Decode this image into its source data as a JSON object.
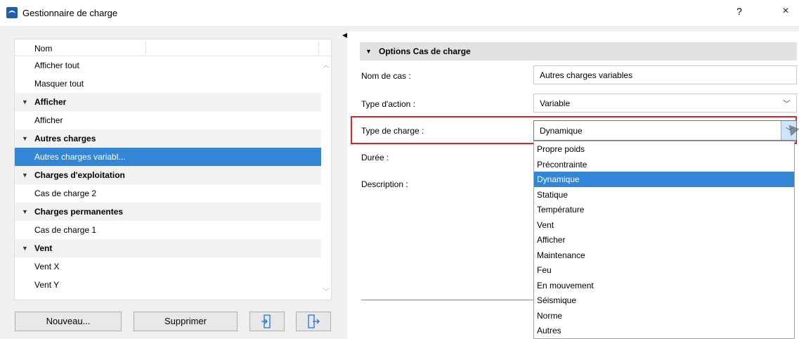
{
  "window": {
    "title": "Gestionnaire de charge",
    "help": "?",
    "close": "×"
  },
  "tree": {
    "column_header": "Nom",
    "rows": [
      {
        "label": "Afficher tout",
        "type": "item"
      },
      {
        "label": "Masquer tout",
        "type": "item"
      },
      {
        "label": "Afficher",
        "type": "group"
      },
      {
        "label": "Afficher",
        "type": "item"
      },
      {
        "label": "Autres charges",
        "type": "group"
      },
      {
        "label": "Autres charges variabl...",
        "type": "item",
        "selected": true
      },
      {
        "label": "Charges d'exploitation",
        "type": "group"
      },
      {
        "label": "Cas de charge 2",
        "type": "item"
      },
      {
        "label": "Charges permanentes",
        "type": "group"
      },
      {
        "label": "Cas de charge 1",
        "type": "item"
      },
      {
        "label": "Vent",
        "type": "group"
      },
      {
        "label": "Vent X",
        "type": "item"
      },
      {
        "label": "Vent Y",
        "type": "item"
      }
    ]
  },
  "buttons": {
    "new": "Nouveau...",
    "delete": "Supprimer",
    "import_icon": "import-icon",
    "export_icon": "export-icon"
  },
  "options": {
    "section_title": "Options Cas de charge",
    "case_name_label": "Nom de cas :",
    "case_name_value": "Autres charges variables",
    "action_type_label": "Type d'action :",
    "action_type_value": "Variable",
    "load_type_label": "Type de charge :",
    "load_type_value": "Dynamique",
    "duration_label": "Durée :",
    "description_label": "Description :"
  },
  "load_type_options": [
    "Propre poids",
    "Précontrainte",
    "Dynamique",
    "Statique",
    "Température",
    "Vent",
    "Afficher",
    "Maintenance",
    "Feu",
    "En mouvement",
    "Séismique",
    "Norme",
    "Autres"
  ],
  "load_type_selected_index": 2,
  "colors": {
    "selection": "#3385d6",
    "highlight": "#e52222"
  }
}
